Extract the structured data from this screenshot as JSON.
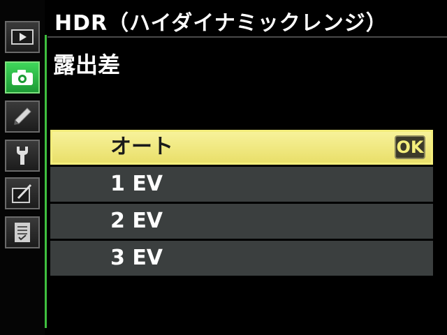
{
  "header": {
    "title": "HDR（ハイダイナミックレンジ）",
    "subtitle": "露出差"
  },
  "sidebar": {
    "tabs": [
      {
        "name": "playback",
        "icon": "playback-icon",
        "active": false
      },
      {
        "name": "shooting",
        "icon": "camera-icon",
        "active": true
      },
      {
        "name": "custom-settings",
        "icon": "pencil-icon",
        "active": false
      },
      {
        "name": "setup",
        "icon": "wrench-icon",
        "active": false
      },
      {
        "name": "retouch",
        "icon": "retouch-icon",
        "active": false
      },
      {
        "name": "my-menu",
        "icon": "my-menu-icon",
        "active": false
      }
    ]
  },
  "options": {
    "items": [
      {
        "label": "オート",
        "selected": true
      },
      {
        "label": "1 EV",
        "selected": false
      },
      {
        "label": "2 EV",
        "selected": false
      },
      {
        "label": "3 EV",
        "selected": false
      }
    ],
    "ok_label": "OK"
  },
  "colors": {
    "accent_green": "#3fbf3f",
    "selected_bg": "#f4ee7c",
    "option_bg": "#3b3f3f",
    "background": "#000000"
  }
}
